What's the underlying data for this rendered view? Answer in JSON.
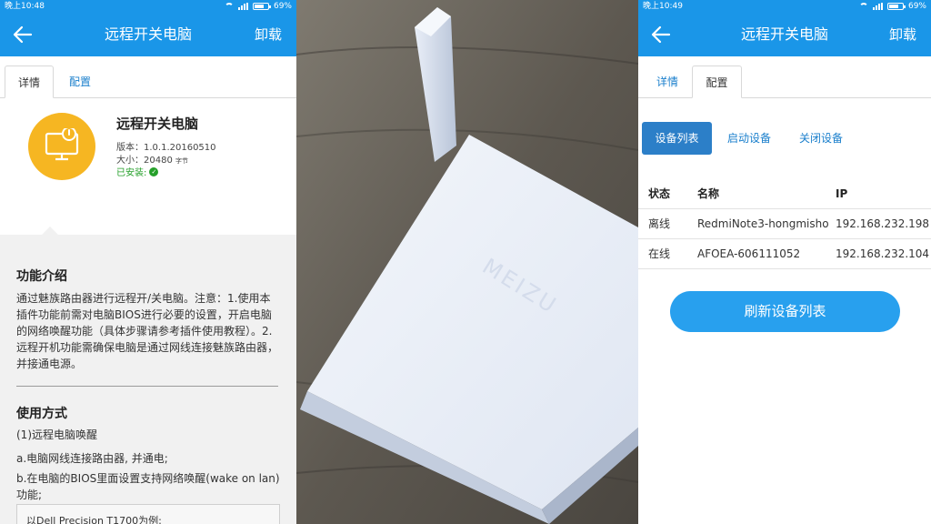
{
  "left": {
    "statusbar": {
      "time": "晚上10:48",
      "battery": "69%"
    },
    "appbar": {
      "title": "远程开关电脑",
      "action": "卸载"
    },
    "tabs": [
      "详情",
      "配置"
    ],
    "app": {
      "name": "远程开关电脑",
      "version": "版本：1.0.1.20160510",
      "size_label": "大小：20480",
      "size_unit": "字节",
      "installed": "已安装:"
    },
    "intro_title": "功能介绍",
    "intro_text": "通过魅族路由器进行远程开/关电脑。注意：1.使用本插件功能前需对电脑BIOS进行必要的设置，开启电脑的网络唤醒功能（具体步骤请参考插件使用教程）。2.远程开机功能需确保电脑是通过网线连接魅族路由器，并接通电源。",
    "usage_title": "使用方式",
    "usage_lines": [
      "(1)远程电脑唤醒",
      "a.电脑网线连接路由器, 并通电;",
      "b.在电脑的BIOS里面设置支持网络唤醒(wake on lan)功能;"
    ],
    "example": "以Dell Precision T1700为例:"
  },
  "photo": {
    "brand": "MEIZU"
  },
  "right": {
    "statusbar": {
      "time": "晚上10:49",
      "battery": "69%"
    },
    "appbar": {
      "title": "远程开关电脑",
      "action": "卸载"
    },
    "tabs": [
      "详情",
      "配置"
    ],
    "buttons": [
      "设备列表",
      "启动设备",
      "关闭设备"
    ],
    "table": {
      "headers": [
        "状态",
        "名称",
        "IP"
      ],
      "rows": [
        [
          "离线",
          "RedmiNote3-hongmisho",
          "192.168.232.198"
        ],
        [
          "在线",
          "AFOEA-606111052",
          "192.168.232.104"
        ]
      ]
    },
    "refresh": "刷新设备列表"
  },
  "colors": {
    "primary": "#1a96e8",
    "accent": "#f6b622",
    "button": "#2c7fc8",
    "installed": "#25a02a"
  }
}
